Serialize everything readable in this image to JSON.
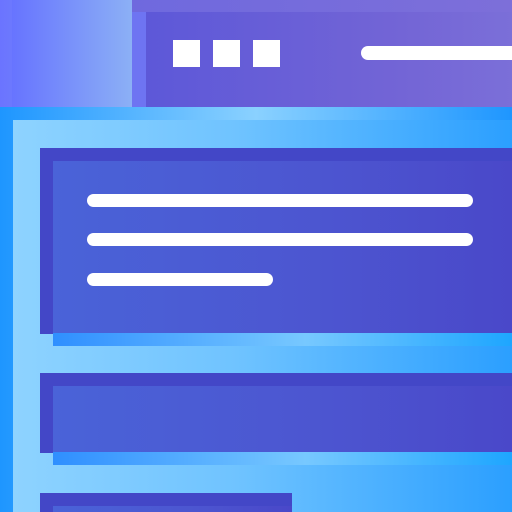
{
  "scene": {
    "description": "",
    "back_window": {
      "controls": [
        "square-icon",
        "square-icon",
        "square-icon"
      ],
      "address_bar": "line"
    },
    "front_window": {
      "cards": [
        {
          "lines": 3
        },
        {
          "lines": 0
        },
        {
          "lines": 0
        }
      ]
    },
    "colors": {
      "purple": "#6f73f2",
      "blue": "#1e96ff",
      "card": "#4c55d0",
      "line": "#ffffff"
    }
  }
}
